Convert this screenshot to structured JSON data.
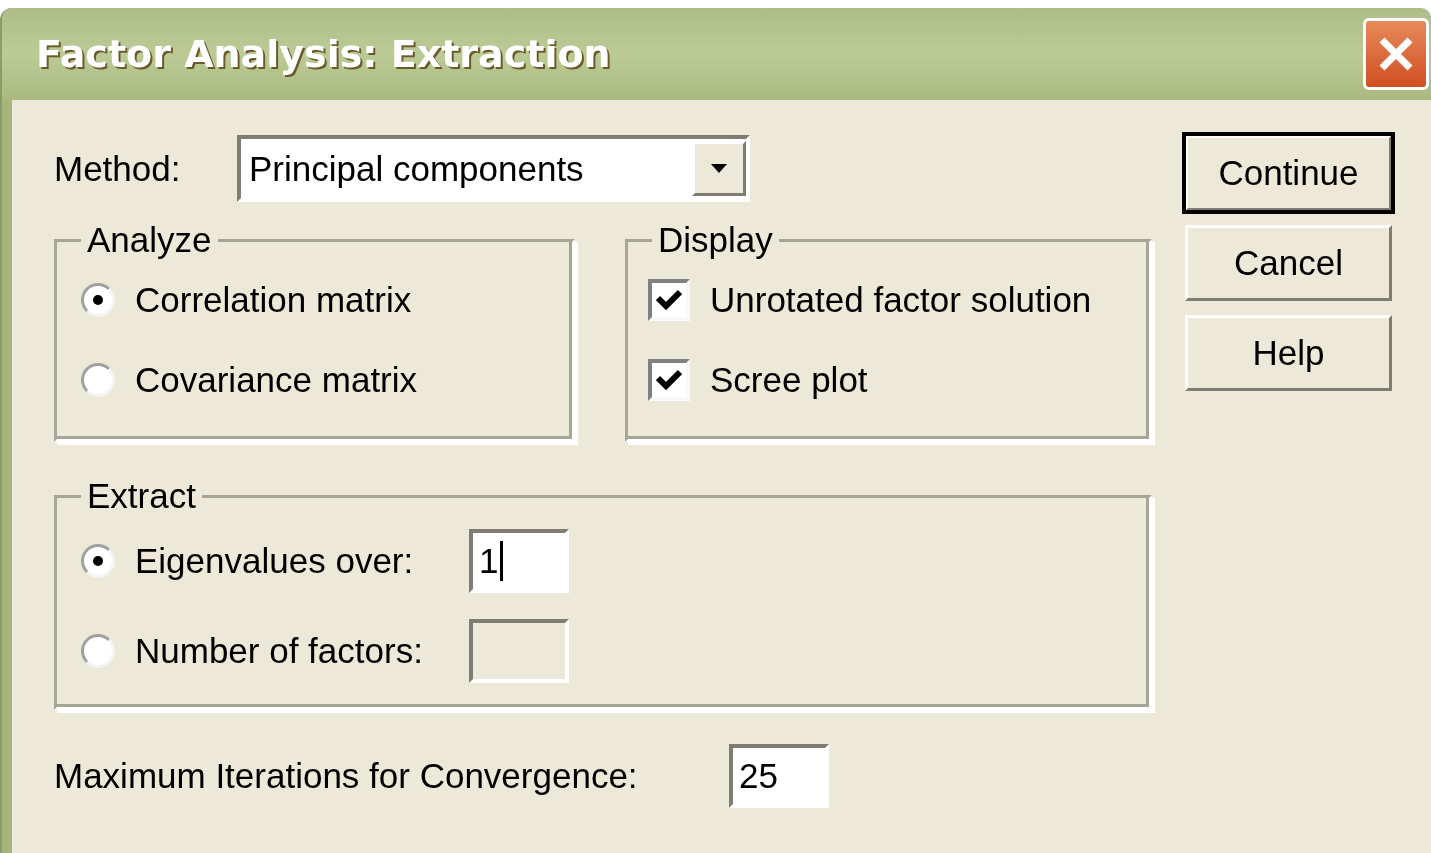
{
  "window": {
    "title": "Factor Analysis: Extraction"
  },
  "method": {
    "label": "Method:",
    "value": "Principal components"
  },
  "analyze": {
    "title": "Analyze",
    "options": [
      {
        "label": "Correlation matrix",
        "selected": true
      },
      {
        "label": "Covariance matrix",
        "selected": false
      }
    ]
  },
  "display": {
    "title": "Display",
    "options": [
      {
        "label": "Unrotated factor solution",
        "checked": true
      },
      {
        "label": "Scree plot",
        "checked": true
      }
    ]
  },
  "extract": {
    "title": "Extract",
    "options": [
      {
        "label": "Eigenvalues over:",
        "selected": true,
        "value": "1",
        "focused": true,
        "disabled": false
      },
      {
        "label": "Number of factors:",
        "selected": false,
        "focused": false,
        "disabled": true
      }
    ]
  },
  "max_iterations": {
    "label": "Maximum Iterations for Convergence:",
    "value": "25"
  },
  "buttons": [
    {
      "label": "Continue",
      "default": true
    },
    {
      "label": "Cancel",
      "default": false
    },
    {
      "label": "Help",
      "default": false
    }
  ]
}
